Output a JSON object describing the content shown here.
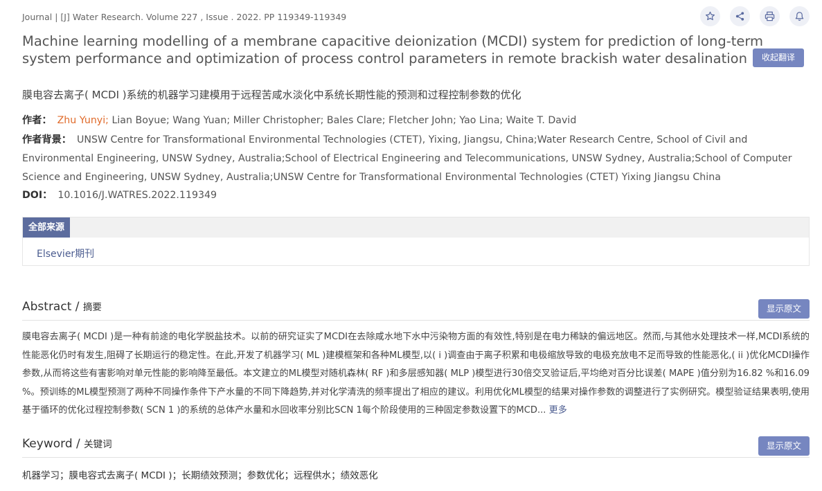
{
  "meta": {
    "prefix": "Journal | [J] ",
    "journal": "Water Research.",
    "rest": " Volume 227 , Issue . 2022. PP 119349-119349"
  },
  "icons": [
    "star-icon",
    "share-icon",
    "print-icon",
    "bell-icon"
  ],
  "title": {
    "en": "Machine learning modelling of a membrane capacitive deionization (MCDI) system for prediction of long-term system performance and optimization of process control parameters in remote brackish water desalination",
    "collapse_label": "收起翻译",
    "cn": "膜电容去离子( MCDI )系统的机器学习建模用于远程苦咸水淡化中系统长期性能的预测和过程控制参数的优化"
  },
  "authors": {
    "label": "作者：",
    "first": "Zhu Yunyi;",
    "rest": " Lian Boyue; Wang Yuan; Miller Christopher; Bales Clare; Fletcher John; Yao Lina; Waite T. David"
  },
  "background": {
    "label": "作者背景：",
    "text": "UNSW Centre for Transformational Environmental Technologies (CTET), Yixing, Jiangsu, China;Water Research Centre, School of Civil and Environmental Engineering, UNSW Sydney, Australia;School of Electrical Engineering and Telecommunications, UNSW Sydney, Australia;School of Computer Science and Engineering, UNSW Sydney, Australia;UNSW Centre for Transformational Environmental Technologies (CTET) Yixing Jiangsu China"
  },
  "doi": {
    "label": "DOI：",
    "value": "10.1016/J.WATRES.2022.119349"
  },
  "sources": {
    "tab": "全部来源",
    "items": [
      "Elsevier期刊"
    ]
  },
  "abstract": {
    "title": "Abstract",
    "sep": " / ",
    "sub": "摘要",
    "show_label": "显示原文",
    "text": "膜电容去离子( MCDI )是一种有前途的电化学脱盐技术。以前的研究证实了MCDI在去除咸水地下水中污染物方面的有效性,特别是在电力稀缺的偏远地区。然而,与其他水处理技术一样,MCDI系统的性能恶化仍时有发生,阻碍了长期运行的稳定性。在此,开发了机器学习( ML )建模框架和各种ML模型,以( i )调查由于离子积累和电极缩放导致的电极充放电不足而导致的性能恶化,( ii )优化MCDI操作参数,从而将这些有害影响对单元性能的影响降至最低。本文建立的ML模型对随机森林( RF )和多层感知器( MLP )模型进行30倍交叉验证后,平均绝对百分比误差( MAPE )值分别为16.82 %和16.09 %。预训练的ML模型预测了两种不同操作条件下产水量的不同下降趋势,并对化学清洗的频率提出了相应的建议。利用优化ML模型的结果对操作参数的调整进行了实例研究。模型验证结果表明,使用基于循环的优化过程控制参数( SCN 1 )的系统的总体产水量和水回收率分别比SCN 1每个阶段使用的三种固定参数设置下的MCD...",
    "more": "更多"
  },
  "keyword": {
    "title": "Keyword",
    "sep": " / ",
    "sub": "关键词",
    "show_label": "显示原文",
    "text": "机器学习；膜电容式去离子( MCDI )；长期绩效预测；参数优化；远程供水；绩效恶化"
  }
}
